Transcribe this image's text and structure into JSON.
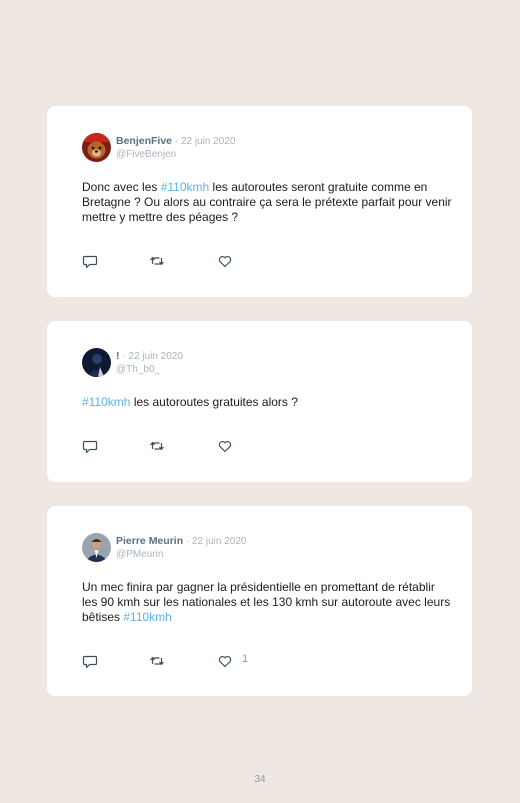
{
  "tweets": [
    {
      "name": "BenjenFive",
      "separator": " · ",
      "date": "22 juin 2020",
      "handle": "@FiveBenjen",
      "text_before": "Donc avec les ",
      "hashtag": "#110kmh",
      "text_after": " les autoroutes seront gratuite comme en Bretagne ? Ou alors au contraire ça sera le prétexte parfait pour venir mettre y mettre des péages ?",
      "likes": "",
      "avatar_icon": "dog-avatar"
    },
    {
      "name": "!",
      "separator": " · ",
      "date": "22 juin 2020",
      "handle": "@Th_b0_",
      "text_before": "",
      "hashtag": "#110kmh",
      "text_after": " les autoroutes gratuites alors ?",
      "likes": "",
      "avatar_icon": "dark-avatar"
    },
    {
      "name": "Pierre Meurin",
      "separator": " · ",
      "date": "22 juin 2020",
      "handle": "@PMeurin",
      "text_before": "Un mec finira par gagner la présidentielle en promettant de rétablir les 90 kmh sur les nationales et les 130 kmh sur autoroute avec leurs bêtises ",
      "hashtag": "#110kmh",
      "text_after": "",
      "likes": "1",
      "avatar_icon": "person-avatar"
    }
  ],
  "icons": {
    "reply": "reply-icon",
    "retweet": "retweet-icon",
    "like": "heart-icon"
  },
  "colors": {
    "background": "#efe7e2",
    "card": "#ffffff",
    "hashtag": "#5fb2e4",
    "name": "#5c6f80",
    "muted": "#a9b4bd"
  },
  "page_number": "34"
}
